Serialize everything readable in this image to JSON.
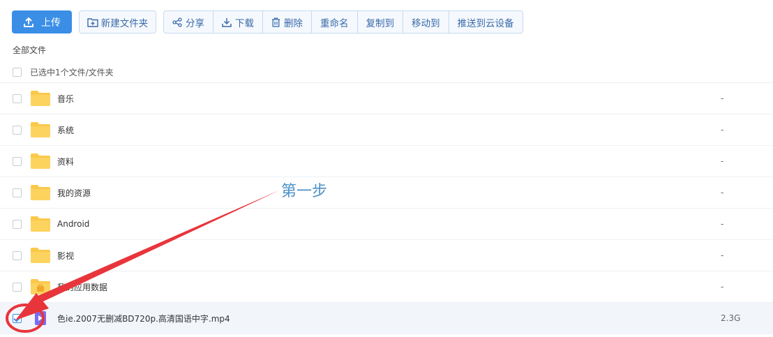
{
  "toolbar": {
    "upload_label": "上传",
    "new_folder_label": "新建文件夹",
    "share_label": "分享",
    "download_label": "下载",
    "delete_label": "删除",
    "rename_label": "重命名",
    "copy_label": "复制到",
    "move_label": "移动到",
    "push_label": "推送到云设备"
  },
  "breadcrumb": "全部文件",
  "selection_text": "已选中1个文件/文件夹",
  "files": [
    {
      "name": "音乐",
      "size": "-",
      "type": "folder",
      "checked": false
    },
    {
      "name": "系统",
      "size": "-",
      "type": "folder",
      "checked": false
    },
    {
      "name": "资料",
      "size": "-",
      "type": "folder",
      "checked": false
    },
    {
      "name": "我的资源",
      "size": "-",
      "type": "folder",
      "checked": false
    },
    {
      "name": "Android",
      "size": "-",
      "type": "folder",
      "checked": false
    },
    {
      "name": "影视",
      "size": "-",
      "type": "folder",
      "checked": false
    },
    {
      "name": "我的应用数据",
      "size": "-",
      "type": "app-folder",
      "checked": false
    },
    {
      "name": "色ie.2007无删减BD720p.高清国语中字.mp4",
      "size": "2.3G",
      "type": "video",
      "checked": true
    }
  ],
  "annotation": {
    "label": "第一步",
    "color": "#e8353b"
  },
  "colors": {
    "accent": "#3a8ee6",
    "folder": "#fbc94a",
    "video": "#7b6cf6"
  }
}
